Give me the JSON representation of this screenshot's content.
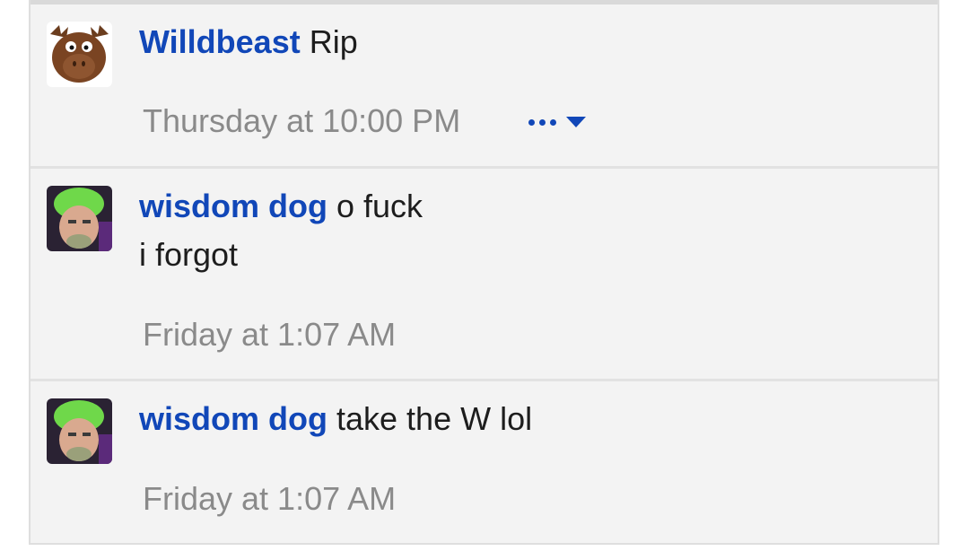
{
  "comments": [
    {
      "author": "Willdbeast",
      "lines": [
        "Rip"
      ],
      "timestamp": "Thursday at 10:00 PM",
      "show_actions": true
    },
    {
      "author": "wisdom dog",
      "lines": [
        "o fuck",
        "i forgot"
      ],
      "timestamp": "Friday at 1:07 AM",
      "show_actions": false
    },
    {
      "author": "wisdom dog",
      "lines": [
        "take the W lol"
      ],
      "timestamp": "Friday at 1:07 AM",
      "show_actions": false
    }
  ],
  "icons": {
    "more": "more-options-icon",
    "expand": "chevron-down-icon"
  },
  "colors": {
    "author_link": "#1147b8",
    "timestamp": "#8a8a8a",
    "text": "#1d1d1d",
    "panel_bg": "#f3f3f3"
  }
}
